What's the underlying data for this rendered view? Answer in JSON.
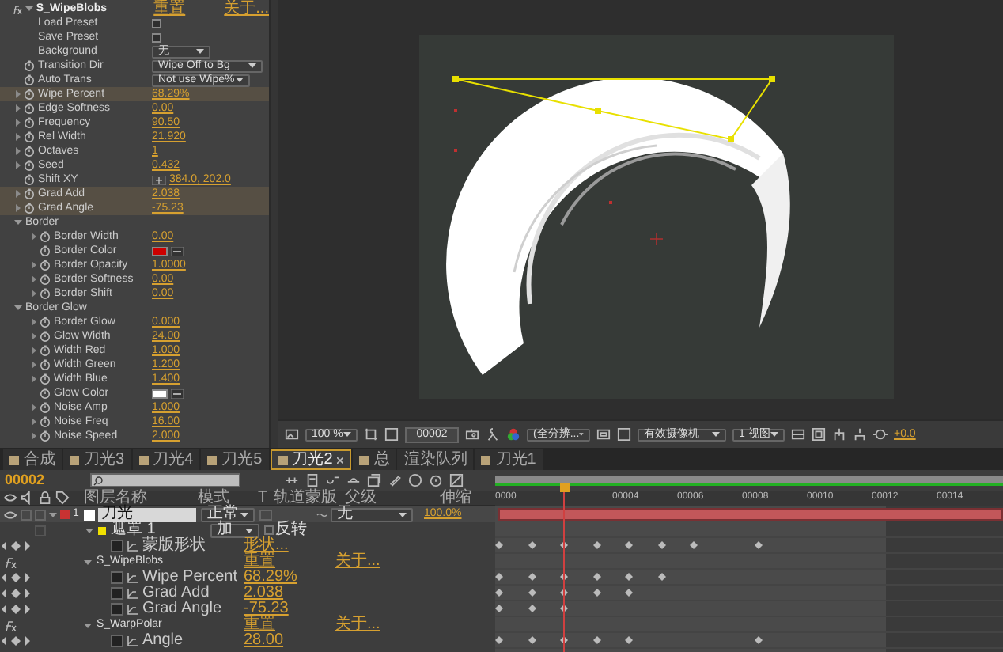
{
  "effect_panel": {
    "items": [
      {
        "kind": "header",
        "label": "S_WipeBlobs",
        "reset": "重置",
        "about": "关于..."
      },
      {
        "kind": "checkbox",
        "label": "Load Preset",
        "checked": false
      },
      {
        "kind": "checkbox",
        "label": "Save Preset",
        "checked": false
      },
      {
        "kind": "dropdown",
        "label": "Background",
        "value": "无",
        "stopwatch": false
      },
      {
        "kind": "dropdown",
        "label": "Transition Dir",
        "value": "Wipe Off to Bg",
        "stopwatch": true
      },
      {
        "kind": "dropdown",
        "label": "Auto Trans",
        "value": "Not use Wipe%",
        "stopwatch": true
      },
      {
        "kind": "value",
        "label": "Wipe Percent",
        "value": "68.29%",
        "highlighted": true
      },
      {
        "kind": "value",
        "label": "Edge Softness",
        "value": "0.00",
        "highlighted": false
      },
      {
        "kind": "value",
        "label": "Frequency",
        "value": "90.50",
        "highlighted": false
      },
      {
        "kind": "value",
        "label": "Rel Width",
        "value": "21.920",
        "highlighted": false
      },
      {
        "kind": "value",
        "label": "Octaves",
        "value": "1",
        "highlighted": false
      },
      {
        "kind": "value",
        "label": "Seed",
        "value": "0.432",
        "highlighted": false
      },
      {
        "kind": "point",
        "label": "Shift XY",
        "value": "384.0, 202.0"
      },
      {
        "kind": "value",
        "label": "Grad Add",
        "value": "2.038",
        "highlighted": true
      },
      {
        "kind": "value",
        "label": "Grad Angle",
        "value": "-75.23",
        "highlighted": true
      },
      {
        "kind": "section",
        "label": "Border",
        "expanded": true,
        "children": [
          {
            "kind": "value",
            "label": "Border Width",
            "value": "0.00",
            "highlighted": false
          },
          {
            "kind": "color",
            "label": "Border Color",
            "color": "#cc0000"
          },
          {
            "kind": "value",
            "label": "Border Opacity",
            "value": "1.0000",
            "highlighted": false
          },
          {
            "kind": "value",
            "label": "Border Softness",
            "value": "0.00",
            "highlighted": false
          },
          {
            "kind": "value",
            "label": "Border Shift",
            "value": "0.00",
            "highlighted": false
          }
        ]
      },
      {
        "kind": "section",
        "label": "Border Glow",
        "expanded": true,
        "children": [
          {
            "kind": "value",
            "label": "Border Glow",
            "value": "0.000",
            "highlighted": false
          },
          {
            "kind": "value",
            "label": "Glow Width",
            "value": "24.00",
            "highlighted": false
          },
          {
            "kind": "value",
            "label": "Width Red",
            "value": "1.000",
            "highlighted": false
          },
          {
            "kind": "value",
            "label": "Width Green",
            "value": "1.200",
            "highlighted": false
          },
          {
            "kind": "value",
            "label": "Width Blue",
            "value": "1.400",
            "highlighted": false
          },
          {
            "kind": "color",
            "label": "Glow Color",
            "color": "#ffffff"
          },
          {
            "kind": "value",
            "label": "Noise Amp",
            "value": "1.000",
            "highlighted": false
          },
          {
            "kind": "value",
            "label": "Noise Freq",
            "value": "16.00",
            "highlighted": false
          },
          {
            "kind": "value",
            "label": "Noise Speed",
            "value": "2.000",
            "highlighted": false
          }
        ]
      }
    ]
  },
  "viewer_toolbar": {
    "magnification": "100 %",
    "timecode": "00002",
    "resolution": "(全分辨...",
    "camera": "有效摄像机",
    "views": "1 视图",
    "exposure": "+0.0"
  },
  "tabs": [
    {
      "label": "合成",
      "selected": false,
      "icon": true
    },
    {
      "label": "刀光3",
      "selected": false,
      "icon": true
    },
    {
      "label": "刀光4",
      "selected": false,
      "icon": true
    },
    {
      "label": "刀光5",
      "selected": false,
      "icon": true
    },
    {
      "label": "刀光2",
      "selected": true,
      "icon": true
    },
    {
      "label": "总",
      "selected": false,
      "icon": true
    },
    {
      "label": "渲染队列",
      "selected": false,
      "icon": false
    },
    {
      "label": "刀光1",
      "selected": false,
      "icon": true
    }
  ],
  "timeline": {
    "current_time": "00002",
    "columns": [
      "图层名称",
      "模式",
      "T",
      "轨道蒙版",
      "父级",
      "伸缩"
    ],
    "ruler": [
      "0000",
      "00004",
      "00006",
      "00008",
      "00010",
      "00012",
      "00014"
    ],
    "rows": [
      {
        "kind": "layer",
        "number": "1",
        "name": "刀光",
        "mode": "正常",
        "parent": "无",
        "stretch": "100.0%",
        "color": "#c83232"
      },
      {
        "kind": "mask",
        "name": "遮罩 1",
        "mode": "加",
        "invert_label": "反转",
        "inverted": false,
        "color": "#f0e000"
      },
      {
        "kind": "property",
        "name": "蒙版形状",
        "value": "形状...",
        "keyframes": [
          true,
          true,
          true,
          true,
          true,
          true,
          true,
          false,
          true
        ]
      },
      {
        "kind": "effect",
        "name": "S_WipeBlobs",
        "reset": "重置",
        "about": "关于..."
      },
      {
        "kind": "property",
        "name": "Wipe Percent",
        "value": "68.29%",
        "keyframes": [
          true,
          true,
          true,
          true,
          true,
          true,
          false,
          false,
          false
        ]
      },
      {
        "kind": "property",
        "name": "Grad Add",
        "value": "2.038",
        "keyframes": [
          true,
          true,
          true,
          true,
          true,
          false,
          false,
          false,
          false
        ]
      },
      {
        "kind": "property",
        "name": "Grad Angle",
        "value": "-75.23",
        "keyframes": [
          true,
          true,
          true,
          false,
          false,
          false,
          false,
          false,
          false
        ]
      },
      {
        "kind": "effect",
        "name": "S_WarpPolar",
        "reset": "重置",
        "about": "关于..."
      },
      {
        "kind": "property",
        "name": "Angle",
        "value": "28.00",
        "keyframes": [
          true,
          true,
          true,
          true,
          true,
          false,
          false,
          false,
          true
        ]
      }
    ]
  }
}
